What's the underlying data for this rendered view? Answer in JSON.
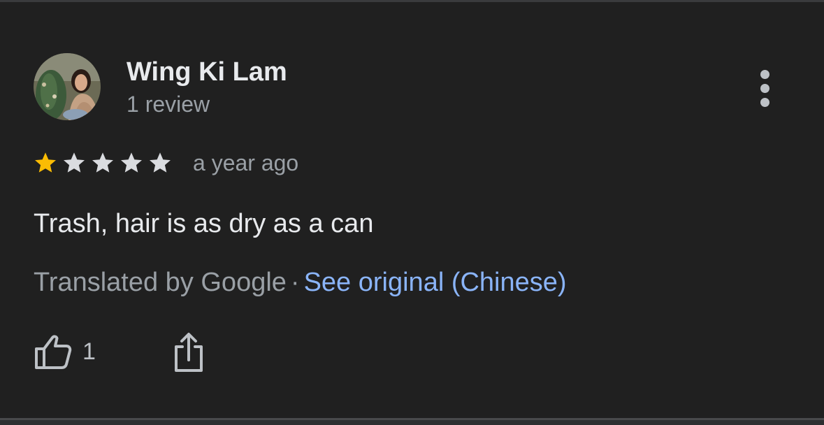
{
  "review": {
    "author_name": "Wing Ki Lam",
    "review_count": "1 review",
    "rating": 1,
    "max_rating": 5,
    "time_ago": "a year ago",
    "text": "Trash, hair is as dry as a can",
    "translated_by": "Translated by Google",
    "separator": "·",
    "see_original": "See original (Chinese)",
    "like_count": "1"
  },
  "icons": {
    "more": "more-vert-icon",
    "like": "thumb-up-icon",
    "share": "share-icon",
    "star_filled": "star-filled-icon",
    "star_empty": "star-empty-icon"
  },
  "colors": {
    "background": "#202020",
    "text_primary": "#e8eaed",
    "text_secondary": "#9aa0a6",
    "link": "#8ab4f8",
    "star_filled": "#fbbc04",
    "star_empty": "#dadce0"
  }
}
